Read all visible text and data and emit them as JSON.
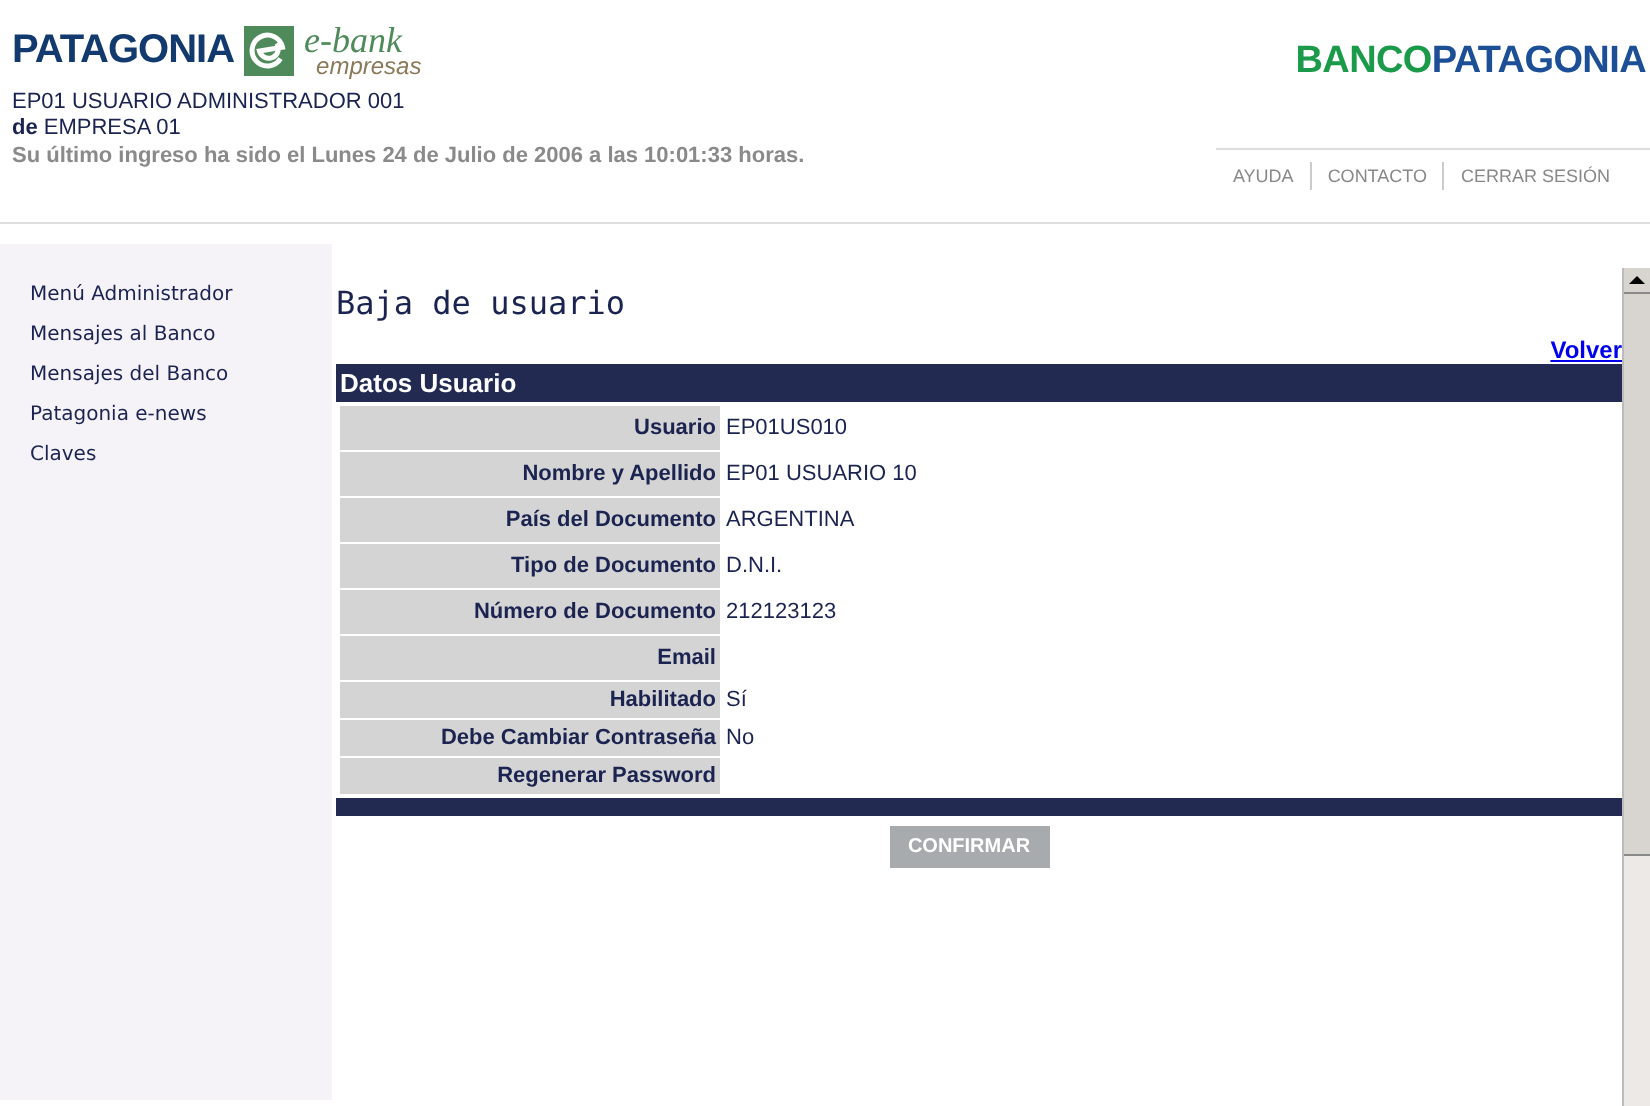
{
  "header": {
    "brand": "PATAGONIA",
    "ebank": "e-bank",
    "ebank_sub": "empresas",
    "bank_logo": [
      "BANCO",
      "PATAGONIA"
    ],
    "user": "EP01 USUARIO ADMINISTRADOR 001",
    "company": "**de** EMPRESA 01",
    "last_login": "Su último ingreso ha sido el Lunes 24 de Julio de 2006 a las 10:01:33 horas.",
    "links": [
      "AYUDA",
      "CONTACTO",
      "CERRAR SESIÓN"
    ]
  },
  "sidebar": {
    "items": [
      {
        "label": "Menú Administrador"
      },
      {
        "label": "Mensajes al Banco"
      },
      {
        "label": "Mensajes del Banco"
      },
      {
        "label": "Patagonia e-news"
      },
      {
        "label": "Claves"
      }
    ]
  },
  "main": {
    "title": "Baja de usuario",
    "back_link": "Volver",
    "section": "Datos Usuario",
    "rows": [
      {
        "label": "Usuario",
        "value": "EP01US010"
      },
      {
        "label": "Nombre y Apellido",
        "value": "EP01 USUARIO 10"
      },
      {
        "label": "País del Documento",
        "value": "ARGENTINA"
      },
      {
        "label": "Tipo de Documento",
        "value": "D.N.I."
      },
      {
        "label": "Número de Documento",
        "value": "212123123"
      },
      {
        "label": "Email"
      },
      {
        "label": "Habilitado",
        "value": "Sí"
      },
      {
        "label": "Debe Cambiar Contraseña",
        "value": "No"
      },
      {
        "label": "Regenerar Password"
      }
    ],
    "confirm": "CONFIRMAR"
  }
}
